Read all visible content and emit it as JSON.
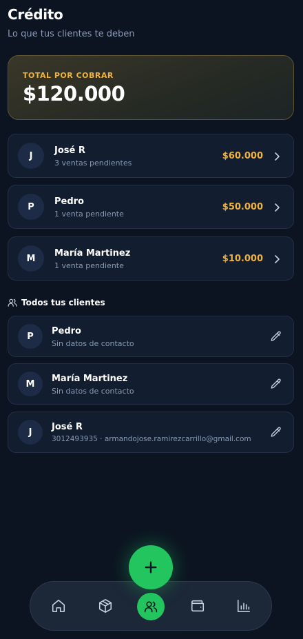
{
  "header": {
    "title": "Crédito",
    "subtitle": "Lo que tus clientes te deben"
  },
  "total": {
    "label": "TOTAL POR COBRAR",
    "value": "$120.000"
  },
  "debtors": [
    {
      "initial": "J",
      "name": "José R",
      "detail": "3 ventas pendientes",
      "amount": "$60.000"
    },
    {
      "initial": "P",
      "name": "Pedro",
      "detail": "1 venta pendiente",
      "amount": "$50.000"
    },
    {
      "initial": "M",
      "name": "María Martinez",
      "detail": "1 venta pendiente",
      "amount": "$10.000"
    }
  ],
  "clients_section": {
    "title": "Todos tus clientes",
    "icon": "users-icon"
  },
  "clients": [
    {
      "initial": "P",
      "name": "Pedro",
      "detail": "Sin datos de contacto"
    },
    {
      "initial": "M",
      "name": "María Martinez",
      "detail": "Sin datos de contacto"
    },
    {
      "initial": "J",
      "name": "José R",
      "detail": "3012493935 · armandojose.ramirezcarrillo@gmail.com"
    }
  ],
  "nav": {
    "items": [
      "home-icon",
      "box-icon",
      "users-icon",
      "wallet-icon",
      "chart-icon"
    ],
    "active": "users-icon"
  },
  "colors": {
    "accent": "#22c55e",
    "amount": "#f0b23b",
    "background": "#0c1421"
  }
}
